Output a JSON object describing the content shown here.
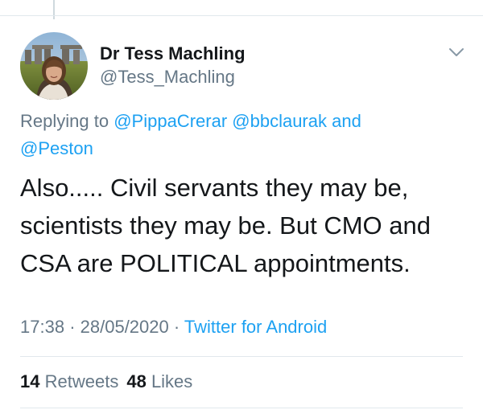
{
  "tweet": {
    "author": {
      "display_name": "Dr Tess Machling",
      "handle": "@Tess_Machling"
    },
    "reply_context": {
      "prefix": "Replying to",
      "mention_1": "@PippaCrerar",
      "mention_2": "@bbclaurak",
      "conjunction": "and",
      "mention_3": "@Peston"
    },
    "text": "Also..... Civil servants they may be, scientists they may be. But CMO and CSA are POLITICAL appointments.",
    "time": "17:38",
    "date": "28/05/2020",
    "separator": "·",
    "source": "Twitter for Android",
    "stats": {
      "retweets_count": "14",
      "retweets_label": "Retweets",
      "likes_count": "48",
      "likes_label": "Likes"
    }
  },
  "icons": {
    "menu": "chevron-down-icon"
  },
  "colors": {
    "link": "#1da1f2",
    "secondary_text": "#657786",
    "primary_text": "#14171a",
    "divider": "#e1e8ed"
  }
}
